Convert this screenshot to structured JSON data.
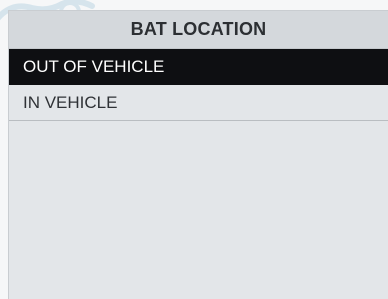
{
  "screen": {
    "title": "BAT LOCATION",
    "options": [
      {
        "label": "OUT OF VEHICLE",
        "selected": true
      },
      {
        "label": "IN VEHICLE",
        "selected": false
      }
    ]
  },
  "colors": {
    "background": "#e3e6e9",
    "title_bar": "#d4d8dc",
    "selected_bg": "#0e0f12",
    "selected_text": "#ffffff",
    "text": "#2f3236"
  },
  "icons": {
    "watermark": "logo-watermark-icon"
  }
}
